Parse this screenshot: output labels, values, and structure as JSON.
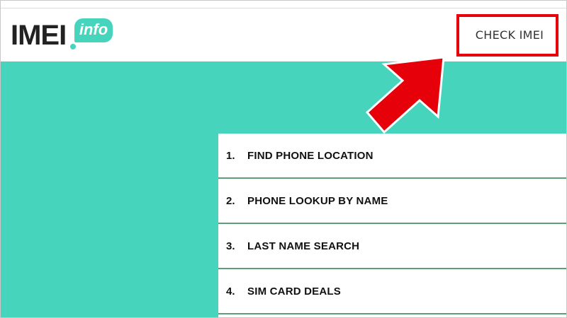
{
  "header": {
    "logo_text": "IMEI",
    "logo_badge": "info",
    "check_link": "CHECK IMEI"
  },
  "menu": {
    "items": [
      {
        "number": "1.",
        "label": "FIND PHONE LOCATION"
      },
      {
        "number": "2.",
        "label": "PHONE LOOKUP BY NAME"
      },
      {
        "number": "3.",
        "label": "LAST NAME SEARCH"
      },
      {
        "number": "4.",
        "label": "SIM CARD DEALS"
      }
    ]
  },
  "colors": {
    "brand_teal": "#47d4bd",
    "highlight_red": "#e5000a",
    "divider_green": "#5e9e76"
  },
  "icons": {
    "annotation": "red-arrow-icon"
  }
}
